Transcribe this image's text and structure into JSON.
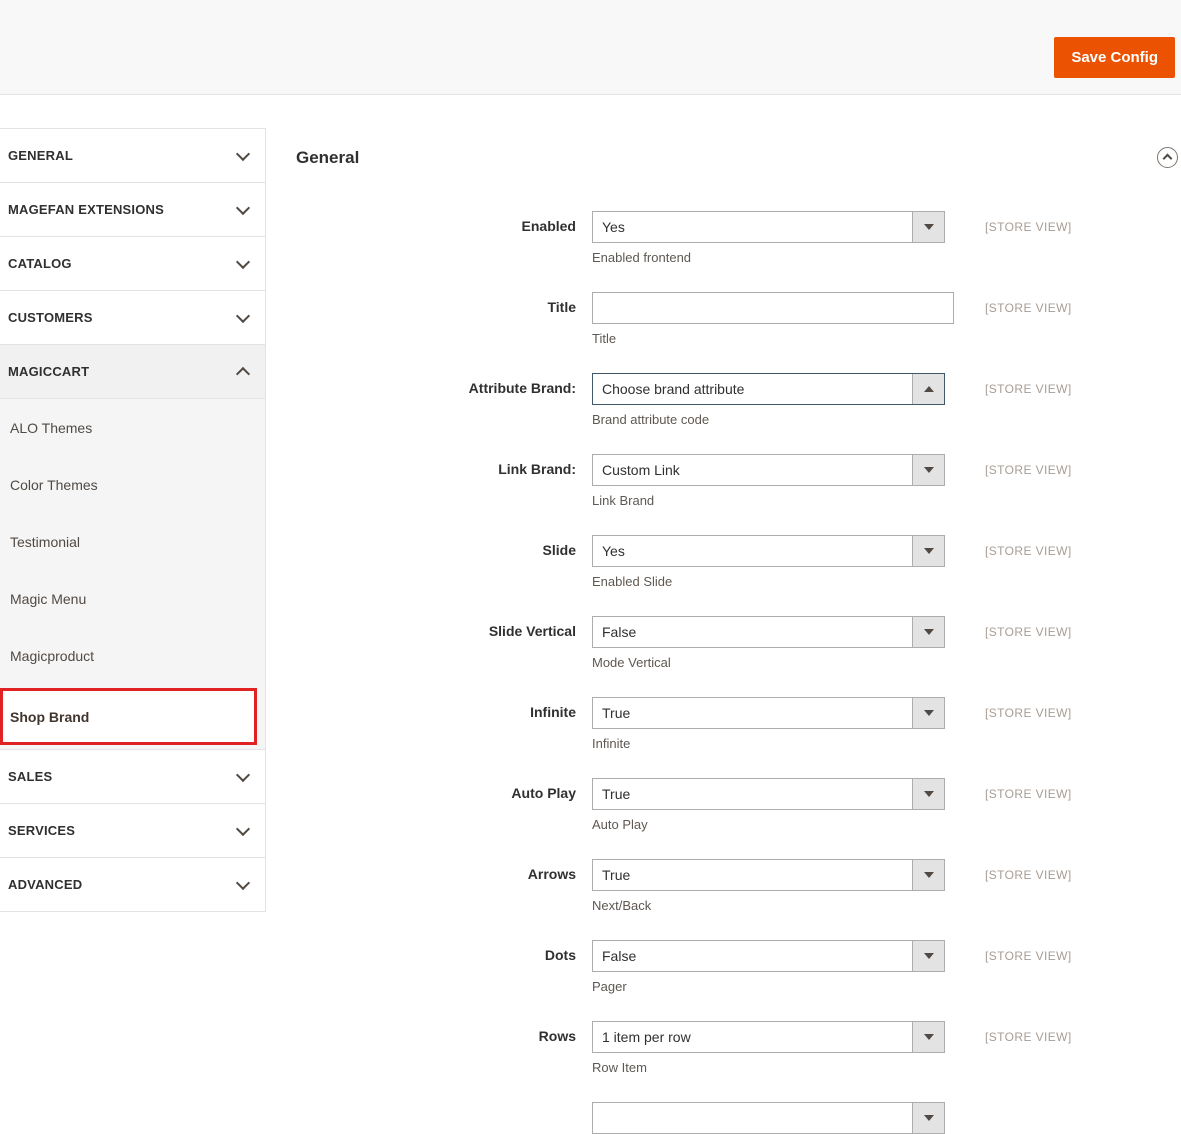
{
  "header": {
    "save_button_label": "Save Config"
  },
  "sidebar": {
    "sections": [
      {
        "label": "GENERAL",
        "state": "collapsed"
      },
      {
        "label": "MAGEFAN EXTENSIONS",
        "state": "collapsed"
      },
      {
        "label": "CATALOG",
        "state": "collapsed"
      },
      {
        "label": "CUSTOMERS",
        "state": "collapsed"
      },
      {
        "label": "MAGICCART",
        "state": "expanded",
        "items": [
          "ALO Themes",
          "Color Themes",
          "Testimonial",
          "Magic Menu",
          "Magicproduct",
          "Shop Brand"
        ],
        "selected_item": "Shop Brand"
      },
      {
        "label": "SALES",
        "state": "collapsed"
      },
      {
        "label": "SERVICES",
        "state": "collapsed"
      },
      {
        "label": "ADVANCED",
        "state": "collapsed"
      }
    ]
  },
  "main": {
    "section_title": "General",
    "scope_label": "[STORE VIEW]",
    "fields": [
      {
        "label": "Enabled",
        "type": "select",
        "value": "Yes",
        "comment": "Enabled frontend"
      },
      {
        "label": "Title",
        "type": "text",
        "value": "",
        "comment": "Title"
      },
      {
        "label": "Attribute Brand:",
        "type": "select",
        "value": "Choose brand attribute",
        "comment": "Brand attribute code",
        "focused": true,
        "open": true
      },
      {
        "label": "Link Brand:",
        "type": "select",
        "value": "Custom Link",
        "comment": "Link Brand"
      },
      {
        "label": "Slide",
        "type": "select",
        "value": "Yes",
        "comment": "Enabled Slide"
      },
      {
        "label": "Slide Vertical",
        "type": "select",
        "value": "False",
        "comment": "Mode Vertical"
      },
      {
        "label": "Infinite",
        "type": "select",
        "value": "True",
        "comment": "Infinite"
      },
      {
        "label": "Auto Play",
        "type": "select",
        "value": "True",
        "comment": "Auto Play"
      },
      {
        "label": "Arrows",
        "type": "select",
        "value": "True",
        "comment": "Next/Back"
      },
      {
        "label": "Dots",
        "type": "select",
        "value": "False",
        "comment": "Pager"
      },
      {
        "label": "Rows",
        "type": "select",
        "value": "1 item per row",
        "comment": "Row Item"
      }
    ],
    "partial_field_visible": true
  },
  "colors": {
    "accent_orange": "#eb5202",
    "highlight_red": "#e02222",
    "focused_select_border": "#40586a",
    "store_view_gray": "#a79d95",
    "header_bar_gray": "#f8f8f8",
    "submenu_gray": "#f5f5f5"
  },
  "icons": {
    "collapse_section": "chevron-up-in-circle",
    "dropdown_closed": "caret-down",
    "dropdown_open": "caret-up",
    "section_collapsed": "chevron-down",
    "section_expanded": "chevron-up"
  }
}
